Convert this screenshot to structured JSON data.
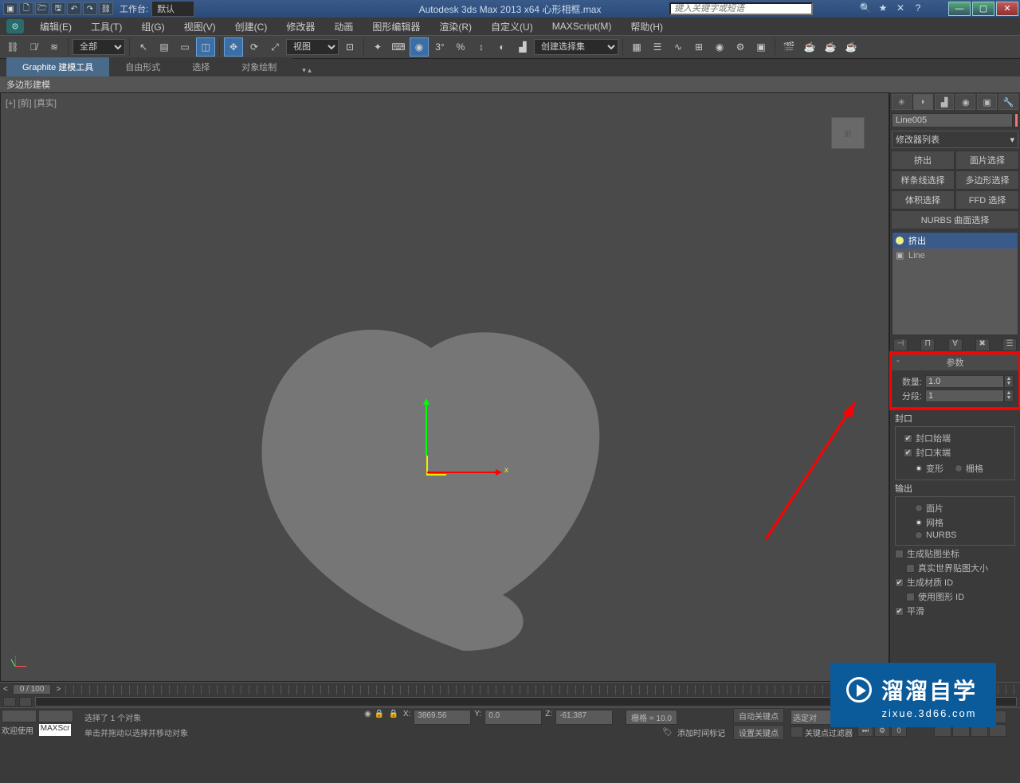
{
  "titlebar": {
    "workspace_label": "工作台:",
    "workspace_value": "默认",
    "app_title": "Autodesk 3ds Max  2013 x64    心形相框.max",
    "search_placeholder": "键入关键字或短语"
  },
  "menu": {
    "items": [
      "编辑(E)",
      "工具(T)",
      "组(G)",
      "视图(V)",
      "创建(C)",
      "修改器",
      "动画",
      "图形编辑器",
      "渲染(R)",
      "自定义(U)",
      "MAXScript(M)",
      "帮助(H)"
    ]
  },
  "toolbar": {
    "filter_dd": "全部",
    "view_dd": "视图",
    "selset_placeholder": "创建选择集"
  },
  "ribbon": {
    "tabs": [
      "Graphite 建模工具",
      "自由形式",
      "选择",
      "对象绘制"
    ],
    "subtab": "多边形建模"
  },
  "viewport": {
    "label": "[+] [前] [真实]",
    "cube_face": "前",
    "axis_x": "x"
  },
  "cmd": {
    "object_name": "Line005",
    "modlist_label": "修改器列表",
    "mod_buttons": [
      "挤出",
      "面片选择",
      "样条线选择",
      "多边形选择",
      "体积选择",
      "FFD 选择"
    ],
    "mod_button_full": "NURBS 曲面选择",
    "stack": {
      "items": [
        "挤出",
        "Line"
      ]
    }
  },
  "params": {
    "title": "参数",
    "amount_label": "数量:",
    "amount_value": "1.0",
    "seg_label": "分段:",
    "seg_value": "1",
    "cap_label": "封口",
    "cap_start": "封口始端",
    "cap_end": "封口末端",
    "deform": "变形",
    "grid": "栅格",
    "output_label": "输出",
    "out_patch": "面片",
    "out_mesh": "网格",
    "out_nurbs": "NURBS",
    "gen_map": "生成贴图坐标",
    "real_world": "真实世界贴图大小",
    "gen_mat": "生成材质 ID",
    "use_shape": "使用图形 ID",
    "smooth": "平滑"
  },
  "timeline": {
    "pos": "0 / 100"
  },
  "status": {
    "welcome": "欢迎使用",
    "maxscr": "MAXScr",
    "line1": "选择了 1 个对象",
    "line2": "单击并拖动以选择并移动对象",
    "x_label": "X:",
    "x_val": "3869.56",
    "y_label": "Y:",
    "y_val": "0.0",
    "z_label": "Z:",
    "z_val": "-61.387",
    "grid": "栅格 = 10.0",
    "addmarker": "添加时间标记",
    "autokey": "自动关键点",
    "setkey": "设置关键点",
    "selset": "选定对",
    "keyfilter": "关键点过滤器"
  },
  "watermark": {
    "title": "溜溜自学",
    "url": "zixue.3d66.com"
  }
}
